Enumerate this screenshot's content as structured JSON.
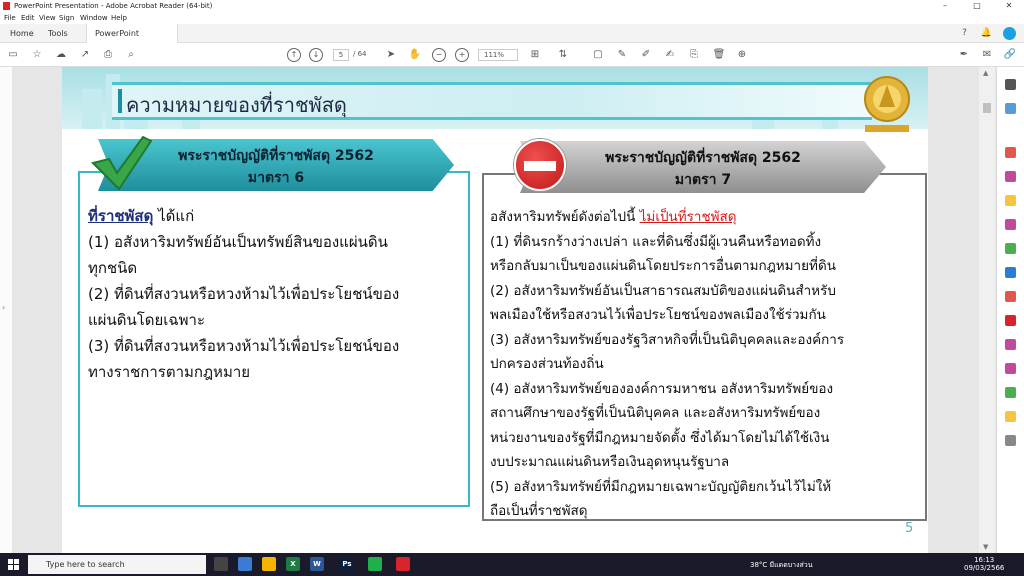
{
  "window": {
    "title": "PowerPoint Presentation - Adobe Acrobat Reader (64-bit)",
    "controls": [
      "–",
      "□",
      "✕"
    ]
  },
  "menu": [
    "File",
    "Edit",
    "View",
    "Sign",
    "Window",
    "Help"
  ],
  "tabs": {
    "home": "Home",
    "tools": "Tools",
    "document": "PowerPoint Present...",
    "close": "×"
  },
  "toolbar": {
    "current_page": "5",
    "page_total": "/ 64",
    "zoom": "111%"
  },
  "slide": {
    "title": "ความหมายของที่ราชพัสดุ",
    "page_number": "5",
    "left": {
      "header_line1": "พระราชบัญญัติที่ราชพัสดุ 2562",
      "header_line2": "มาตรา 6",
      "term": "ที่ราชพัสดุ",
      "term_suffix": " ได้แก่",
      "lines": [
        "(1) อสังหาริมทรัพย์อันเป็นทรัพย์สินของแผ่นดิน",
        "ทุกชนิด",
        "(2) ที่ดินที่สงวนหรือหวงห้ามไว้เพื่อประโยชน์ของ",
        "แผ่นดินโดยเฉพาะ",
        "(3) ที่ดินที่สงวนหรือหวงห้ามไว้เพื่อประโยชน์ของ",
        "ทางราชการตามกฎหมาย"
      ]
    },
    "right": {
      "header_line1": "พระราชบัญญัติที่ราชพัสดุ 2562",
      "header_line2": "มาตรา 7",
      "intro": "อสังหาริมทรัพย์ดังต่อไปนี้ ",
      "intro_red": "ไม่เป็นที่ราชพัสดุ",
      "lines": [
        "(1) ที่ดินรกร้างว่างเปล่า และที่ดินซึ่งมีผู้เวนคืนหรือทอดทิ้ง",
        "หรือกลับมาเป็นของแผ่นดินโดยประการอื่นตามกฎหมายที่ดิน",
        "(2) อสังหาริมทรัพย์อันเป็นสาธารณสมบัติของแผ่นดินสำหรับ",
        "พลเมืองใช้หรือสงวนไว้เพื่อประโยชน์ของพลเมืองใช้ร่วมกัน",
        "(3) อสังหาริมทรัพย์ของรัฐวิสาหกิจที่เป็นนิติบุคคลและองค์การ",
        "ปกครองส่วนท้องถิ่น",
        "(4) อสังหาริมทรัพย์ขององค์การมหาชน อสังหาริมทรัพย์ของ",
        "สถานศึกษาของรัฐที่เป็นนิติบุคคล และอสังหาริมทรัพย์ของ",
        "หน่วยงานของรัฐที่มีกฎหมายจัดตั้ง ซึ่งได้มาโดยไม่ได้ใช้เงิน",
        "งบประมาณแผ่นดินหรือเงินอุดหนุนรัฐบาล",
        "(5) อสังหาริมทรัพย์ที่มีกฎหมายเฉพาะบัญญัติยกเว้นไว้ไม่ให้",
        "ถือเป็นที่ราชพัสดุ"
      ]
    }
  },
  "taskbar": {
    "search_placeholder": "Type here to search",
    "weather": "38°C  มีแดดบางส่วน",
    "time": "16:13",
    "date": "09/03/2566"
  },
  "colors": {
    "teal": "#35b9c4",
    "red": "#d21b1b",
    "acrobat_red": "#d8232a"
  }
}
